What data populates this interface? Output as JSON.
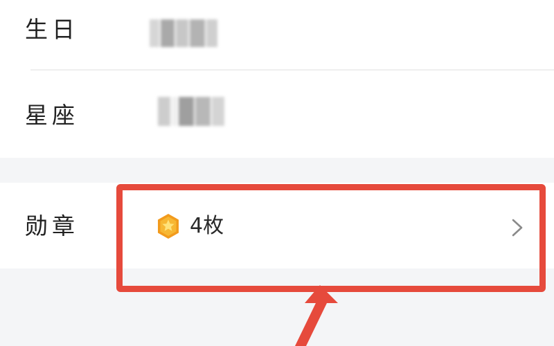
{
  "profile": {
    "birthday_label": "生日",
    "constellation_label": "星座",
    "badge_label": "勋章",
    "badge_count": "4枚"
  },
  "icons": {
    "badge": "star-medal-icon",
    "chevron": "chevron-right-icon"
  },
  "colors": {
    "highlight": "#e64a3c",
    "badge_orange": "#f29b1d",
    "badge_yellow": "#ffd54a"
  }
}
